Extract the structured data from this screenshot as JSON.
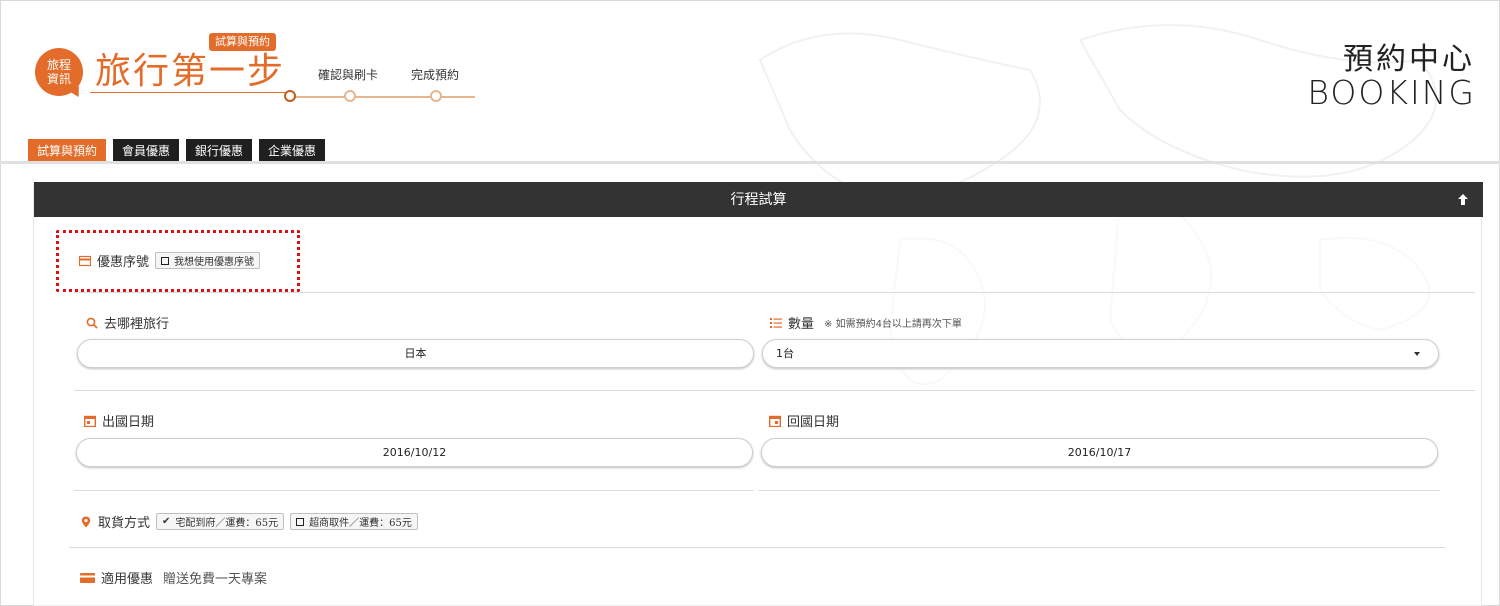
{
  "header": {
    "badge_line1": "旅程",
    "badge_line2": "資訊",
    "step_tag": "試算與預約",
    "title": "旅行第一步",
    "steps": [
      "確認與刷卡",
      "完成預約"
    ],
    "booking_cn": "預約中心",
    "booking_en": "BOOKING"
  },
  "tabs": [
    {
      "label": "試算與預約",
      "active": true
    },
    {
      "label": "會員優惠",
      "active": false
    },
    {
      "label": "銀行優惠",
      "active": false
    },
    {
      "label": "企業優惠",
      "active": false
    }
  ],
  "panel": {
    "title": "行程試算",
    "coupon": {
      "label": "優惠序號",
      "checkbox_label": "我想使用優惠序號"
    },
    "destination": {
      "label": "去哪裡旅行",
      "value": "日本"
    },
    "quantity": {
      "label": "數量",
      "note": "※ 如需預約4台以上請再次下單",
      "value": "1台"
    },
    "depart_date": {
      "label": "出國日期",
      "value": "2016/10/12"
    },
    "return_date": {
      "label": "回國日期",
      "value": "2016/10/17"
    },
    "pickup": {
      "label": "取貨方式",
      "options": [
        {
          "label": "宅配到府／運費：65元",
          "checked": true
        },
        {
          "label": "超商取件／運費：65元",
          "checked": false
        }
      ]
    },
    "promo": {
      "label": "適用優惠",
      "value": "贈送免費一天專案"
    }
  },
  "colors": {
    "accent": "#e36c2a",
    "header_bar": "#333333",
    "tab_dark": "#1f1f1f",
    "dotted_border": "#dd1111"
  }
}
